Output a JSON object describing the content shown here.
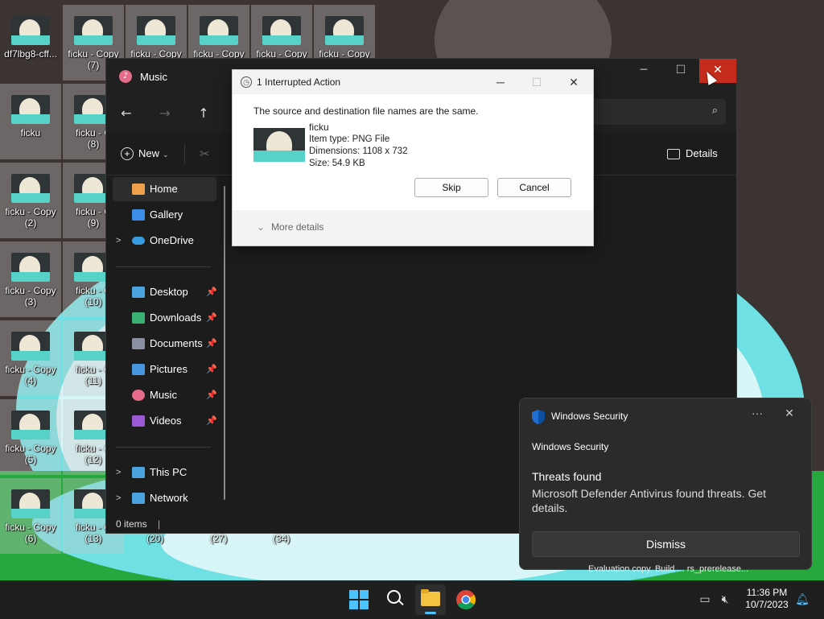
{
  "desktop": {
    "icons": [
      {
        "label": "df7lbg8-cff...",
        "label2": ""
      },
      {
        "label": "ficku - Copy",
        "label2": "(7)"
      },
      {
        "label": "ficku - Copy",
        "label2": ""
      },
      {
        "label": "ficku - Copy",
        "label2": ""
      },
      {
        "label": "ficku - Copy",
        "label2": ""
      },
      {
        "label": "ficku - Copy",
        "label2": ""
      },
      {
        "label": "ficku",
        "label2": ""
      },
      {
        "label": "ficku - C",
        "label2": "(8)"
      },
      {
        "label": "ficku - Copy",
        "label2": "(2)"
      },
      {
        "label": "ficku - C",
        "label2": "(9)"
      },
      {
        "label": "ficku - Copy",
        "label2": "(3)"
      },
      {
        "label": "ficku - C",
        "label2": "(10)"
      },
      {
        "label": "ficku - Copy",
        "label2": "(4)"
      },
      {
        "label": "ficku - C",
        "label2": "(11)"
      },
      {
        "label": "ficku - Copy",
        "label2": "(5)"
      },
      {
        "label": "ficku - C",
        "label2": "(12)"
      },
      {
        "label": "ficku - Copy",
        "label2": "(6)"
      },
      {
        "label": "ficku - C",
        "label2": "(13)"
      }
    ],
    "partial_labels": [
      "(20)",
      "(27)",
      "(34)"
    ]
  },
  "explorer": {
    "title": "Music",
    "toolbar": {
      "new_label": "New",
      "details_label": "Details"
    },
    "sidebar": {
      "items": [
        {
          "label": "Home",
          "icon": "home-icon",
          "color": "#f0a04b",
          "pinned": false,
          "chevron": false,
          "active": true
        },
        {
          "label": "Gallery",
          "icon": "gallery-icon",
          "color": "#3d8ee8",
          "pinned": false,
          "chevron": false,
          "active": false
        },
        {
          "label": "OneDrive",
          "icon": "onedrive-icon",
          "color": "#3a9ce0",
          "pinned": false,
          "chevron": true,
          "active": false
        },
        {
          "label": "Desktop",
          "icon": "desktop-icon",
          "color": "#4aa3df",
          "pinned": true,
          "chevron": false,
          "active": false
        },
        {
          "label": "Downloads",
          "icon": "downloads-icon",
          "color": "#3bb273",
          "pinned": true,
          "chevron": false,
          "active": false
        },
        {
          "label": "Documents",
          "icon": "documents-icon",
          "color": "#8a8fa3",
          "pinned": true,
          "chevron": false,
          "active": false
        },
        {
          "label": "Pictures",
          "icon": "pictures-icon",
          "color": "#4a95e0",
          "pinned": true,
          "chevron": false,
          "active": false
        },
        {
          "label": "Music",
          "icon": "music-icon",
          "color": "#e46b8a",
          "pinned": true,
          "chevron": false,
          "active": false
        },
        {
          "label": "Videos",
          "icon": "videos-icon",
          "color": "#9b59d6",
          "pinned": true,
          "chevron": false,
          "active": false
        },
        {
          "label": "This PC",
          "icon": "this-pc-icon",
          "color": "#4aa3df",
          "pinned": false,
          "chevron": true,
          "active": false
        },
        {
          "label": "Network",
          "icon": "network-icon",
          "color": "#4aa3df",
          "pinned": false,
          "chevron": true,
          "active": false
        }
      ]
    },
    "status": "0 items"
  },
  "dialog": {
    "title": "1 Interrupted Action",
    "message": "The source and destination file names are the same.",
    "file": {
      "name": "ficku",
      "type": "Item type: PNG File",
      "dimensions": "Dimensions: 1108 x 732",
      "size": "Size: 54.9 KB"
    },
    "skip_label": "Skip",
    "cancel_label": "Cancel",
    "more_details_label": "More details"
  },
  "toast": {
    "app_name": "Windows Security",
    "source": "Windows Security",
    "heading": "Threats found",
    "body": "Microsoft Defender Antivirus found threats. Get details.",
    "dismiss_label": "Dismiss"
  },
  "watermark": "Evaluation copy. Build ... rs_prerelease...",
  "taskbar": {
    "time": "11:36 PM",
    "date": "10/7/2023"
  },
  "colors": {
    "accent": "#4cc2ff",
    "close_red": "#c42b1c",
    "wallpaper_cyan": "#67d9dc",
    "wallpaper_green": "#2fb34a"
  }
}
